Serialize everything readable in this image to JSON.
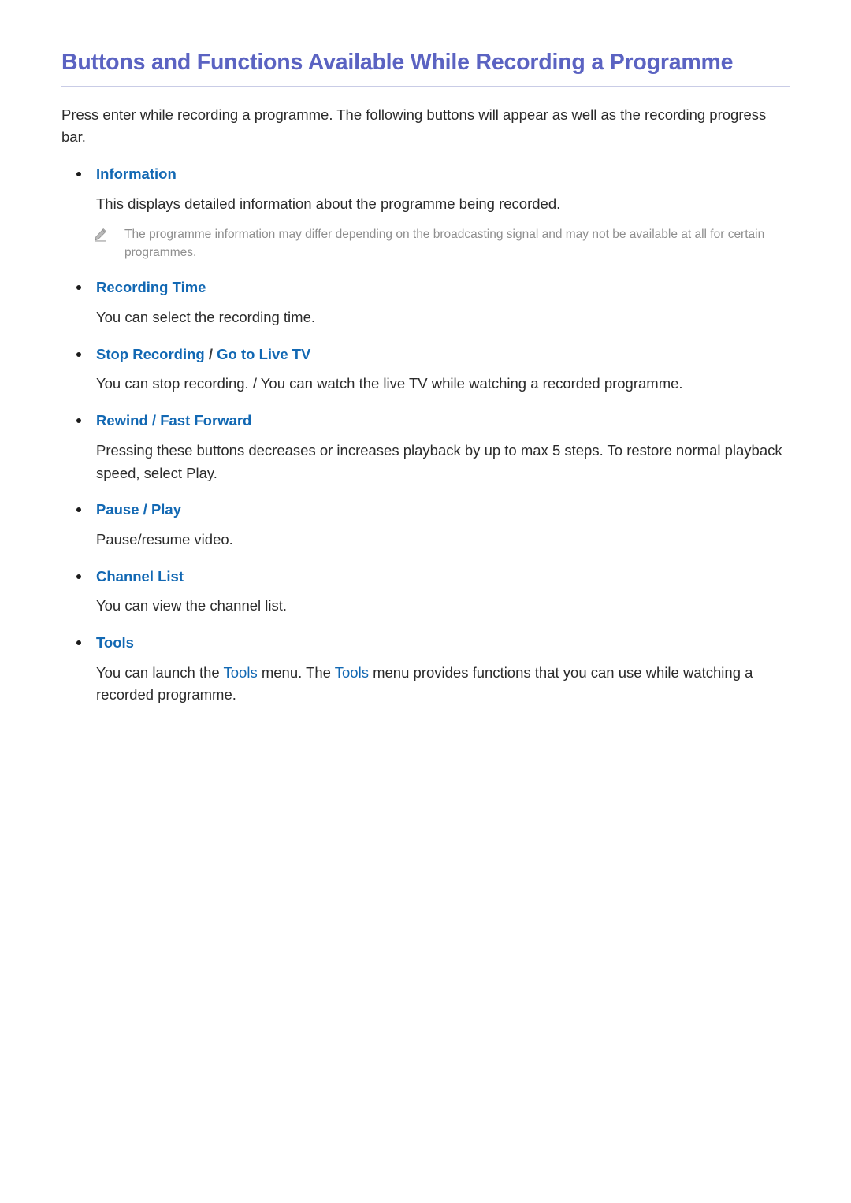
{
  "document": {
    "title": "Buttons and Functions Available While Recording a Programme",
    "intro": "Press enter while recording a programme. The following buttons will appear as well as the recording progress bar.",
    "accent_title_color": "#5b63c2",
    "accent_heading_color": "#1268b3",
    "note_text_color": "#8e8e8e",
    "body_text_color": "#2b2b2b"
  },
  "sections": [
    {
      "heading": "Information",
      "heading_parts": {
        "first": "Information",
        "separator": "",
        "second": ""
      },
      "body": "This displays detailed information about the programme being recorded.",
      "note": {
        "icon": "pencil-note-icon",
        "text": "The programme information may differ depending on the broadcasting signal and may not be available at all for certain programmes."
      }
    },
    {
      "heading": "Recording Time",
      "heading_parts": {
        "first": "Recording Time",
        "separator": "",
        "second": ""
      },
      "body": "You can select the recording time."
    },
    {
      "heading": "Stop Recording / Go to Live TV",
      "heading_parts": {
        "first": "Stop Recording",
        "separator": "/",
        "second": "Go to Live TV"
      },
      "body": "You can stop recording. / You can watch the live TV while watching a recorded programme."
    },
    {
      "heading": "Rewind / Fast Forward",
      "heading_parts": {
        "first": "Rewind",
        "separator": "/",
        "second": "Fast Forward"
      },
      "body": "Pressing these buttons decreases or increases playback by up to max 5 steps. To restore normal playback speed, select Play."
    },
    {
      "heading": "Pause / Play",
      "heading_parts": {
        "first": "Pause",
        "separator": "/",
        "second": "Play"
      },
      "body": "Pause/resume video."
    },
    {
      "heading": "Channel List",
      "heading_parts": {
        "first": "Channel List",
        "separator": "",
        "second": ""
      },
      "body": "You can view the channel list."
    },
    {
      "heading": "Tools",
      "heading_parts": {
        "first": "Tools",
        "separator": "",
        "second": ""
      },
      "body_rich": {
        "part1": "You can launch the ",
        "keyword1": "Tools",
        "part2": " menu. The ",
        "keyword2": "Tools",
        "part3": " menu provides functions that you can use while watching a recorded programme."
      }
    }
  ]
}
